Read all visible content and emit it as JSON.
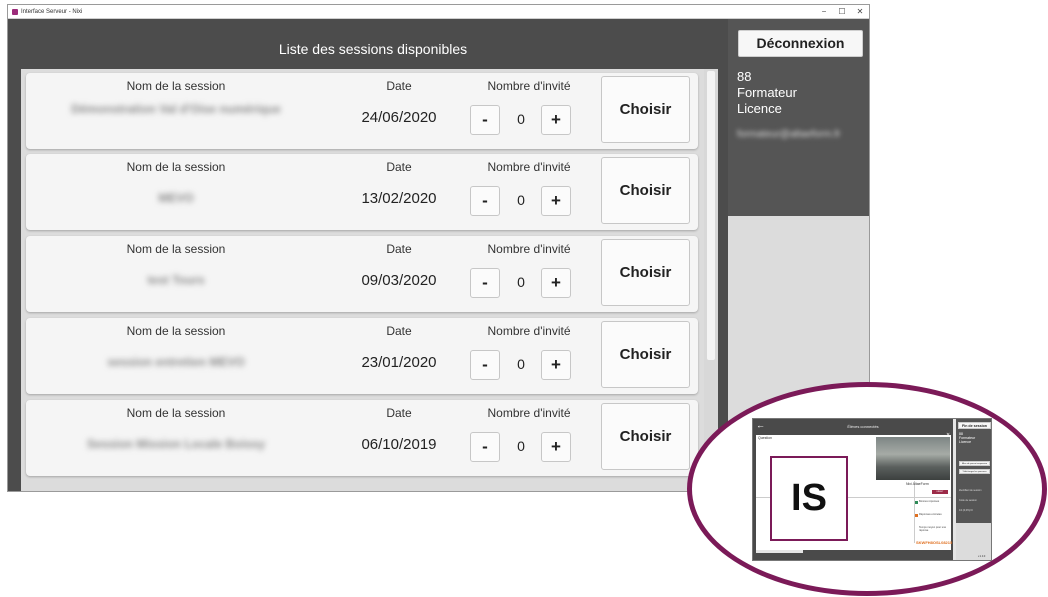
{
  "window": {
    "title": "Interface Serveur - Nixi",
    "controls": {
      "minimize": "−",
      "maximize": "☐",
      "close": "✕"
    }
  },
  "main": {
    "list_title": "Liste des sessions disponibles",
    "column_labels": {
      "name": "Nom de la session",
      "date": "Date",
      "guests": "Nombre d'invité"
    },
    "choose_label": "Choisir",
    "minus_label": "-",
    "plus_label": "+",
    "sessions": [
      {
        "name": "Démonstration Val d'Oise numérique",
        "date": "24/06/2020",
        "guests": "0"
      },
      {
        "name": "MEVO",
        "date": "13/02/2020",
        "guests": "0"
      },
      {
        "name": "test Tours",
        "date": "09/03/2020",
        "guests": "0"
      },
      {
        "name": "session entretien MEVO",
        "date": "23/01/2020",
        "guests": "0"
      },
      {
        "name": "Session Mission Locale Boissy",
        "date": "06/10/2019",
        "guests": "0"
      }
    ]
  },
  "sidebar": {
    "logout_label": "Déconnexion",
    "user": {
      "id": "88",
      "name": "Formateur",
      "role": "Licence",
      "email": "formateur@altaeform.fr"
    }
  },
  "preview": {
    "badge": "IS",
    "screen_title": "Élèves connectés",
    "question_label": "Question",
    "user_name": "Nixi AltaeForm",
    "red_button": "DÉBUT",
    "legend": [
      "Bonnes réponses",
      "Réponses erronées",
      "Temps moyen pour une réponse"
    ],
    "session_code": "SKWFH8OSL08215",
    "end_button": "Fin de session",
    "user_lines": [
      "88",
      "Formateur",
      "Licence"
    ],
    "small_buttons": [
      "Mise de pause temporaire",
      "Télécharger les parcours"
    ],
    "right_info": [
      "Identifiant de session",
      "Code de session",
      "1/4 (0,0%)=0"
    ],
    "bottom_right": "v.1.0.0"
  }
}
